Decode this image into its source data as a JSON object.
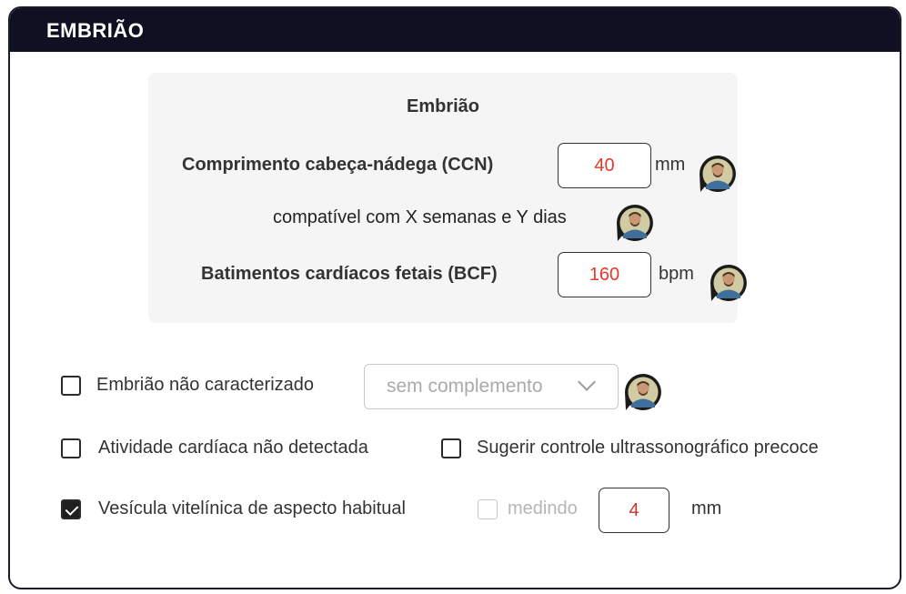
{
  "section": {
    "title": "EMBRIÃO"
  },
  "panel": {
    "title": "Embrião",
    "ccn": {
      "label": "Comprimento cabeça-nádega (CCN)",
      "value": "40",
      "unit": "mm"
    },
    "compatible_text": "compatível com X semanas e Y dias",
    "bcf": {
      "label": "Batimentos cardíacos fetais (BCF)",
      "value": "160",
      "unit": "bpm"
    }
  },
  "options": {
    "nao_caracterizado": {
      "label": "Embrião não caracterizado",
      "checked": false,
      "select_value": "sem complemento"
    },
    "atividade": {
      "label": "Atividade cardíaca não detectada",
      "checked": false
    },
    "sugerir": {
      "label": "Sugerir controle ultrassonográfico precoce",
      "checked": false
    },
    "vesicula": {
      "label": "Vesícula vitelínica de aspecto habitual",
      "checked": true,
      "medindo_label": "medindo",
      "medindo_checked": false,
      "value": "4",
      "unit": "mm"
    }
  },
  "colors": {
    "header_bg": "#0f1123",
    "input_value": "#e5392b",
    "vesicula_value": "#c0392b"
  },
  "icons": {
    "avatar": "user-avatar-icon",
    "check": "check-icon",
    "chevron": "chevron-down-icon"
  }
}
